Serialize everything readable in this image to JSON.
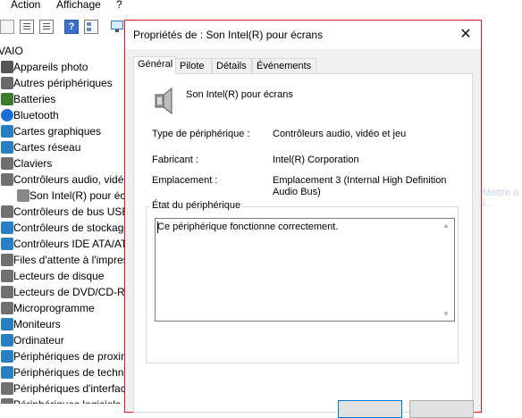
{
  "menu": {
    "items": [
      "Action",
      "Affichage",
      "?"
    ]
  },
  "tree": {
    "root": "VAIO",
    "items": [
      {
        "label": "Appareils photo",
        "icon": "camera-icon",
        "color": "#555555"
      },
      {
        "label": "Autres périphériques",
        "icon": "unknown-device-icon",
        "color": "#6a6a6a"
      },
      {
        "label": "Batteries",
        "icon": "battery-icon",
        "color": "#3a7d2c"
      },
      {
        "label": "Bluetooth",
        "icon": "bluetooth-icon",
        "color": "#1a6fd6"
      },
      {
        "label": "Cartes graphiques",
        "icon": "display-adapter-icon",
        "color": "#2a7fc4"
      },
      {
        "label": "Cartes réseau",
        "icon": "network-adapter-icon",
        "color": "#2a7fc4"
      },
      {
        "label": "Claviers",
        "icon": "keyboard-icon",
        "color": "#707070"
      },
      {
        "label": "Contrôleurs audio, vidéo",
        "icon": "audio-controller-icon",
        "color": "#707070"
      },
      {
        "label": "Son Intel(R) pour écr",
        "icon": "speaker-icon",
        "color": "#888888",
        "child": true
      },
      {
        "label": "Contrôleurs de bus USB",
        "icon": "usb-icon",
        "color": "#707070"
      },
      {
        "label": "Contrôleurs de stockage",
        "icon": "storage-controller-icon",
        "color": "#2a7fc4"
      },
      {
        "label": "Contrôleurs IDE ATA/AT",
        "icon": "ide-controller-icon",
        "color": "#2a7fc4"
      },
      {
        "label": "Files d'attente à l'impres",
        "icon": "print-queue-icon",
        "color": "#707070"
      },
      {
        "label": "Lecteurs de disque",
        "icon": "disk-drive-icon",
        "color": "#707070"
      },
      {
        "label": "Lecteurs de DVD/CD-RO",
        "icon": "dvd-drive-icon",
        "color": "#707070"
      },
      {
        "label": "Microprogramme",
        "icon": "firmware-icon",
        "color": "#707070"
      },
      {
        "label": "Moniteurs",
        "icon": "monitor-icon",
        "color": "#2a7fc4"
      },
      {
        "label": "Ordinateur",
        "icon": "computer-icon",
        "color": "#2a7fc4"
      },
      {
        "label": "Périphériques de proxim",
        "icon": "proximity-device-icon",
        "color": "#2a7fc4"
      },
      {
        "label": "Périphériques de techno",
        "icon": "tech-device-icon",
        "color": "#2a7fc4"
      },
      {
        "label": "Périphériques d'interfac",
        "icon": "hid-icon",
        "color": "#707070"
      },
      {
        "label": "Périphériques logiciels",
        "icon": "software-device-icon",
        "color": "#707070"
      }
    ]
  },
  "dialog": {
    "title": "Propriétés de : Son Intel(R) pour écrans",
    "tabs": [
      {
        "label": "Général",
        "active": true
      },
      {
        "label": "Pilote",
        "active": false
      },
      {
        "label": "Détails",
        "active": false
      },
      {
        "label": "Événements",
        "active": false
      }
    ],
    "device_name": "Son Intel(R) pour écrans",
    "props": [
      {
        "label": "Type de périphérique :",
        "value": "Contrôleurs audio, vidéo et jeu"
      },
      {
        "label": "Fabricant :",
        "value": "Intel(R) Corporation"
      },
      {
        "label": "Emplacement :",
        "value": "Emplacement 3 (Internal High Definition Audio Bus)"
      }
    ],
    "status_group_title": "État du périphérique",
    "status_text": "Ce périphérique fonctionne correctement."
  },
  "background_text": "Mettre à l..."
}
